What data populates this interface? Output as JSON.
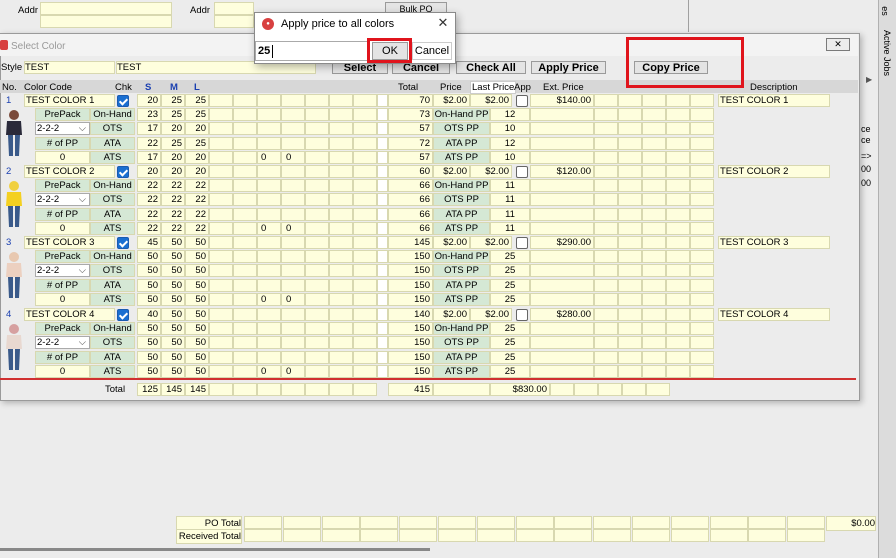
{
  "background": {
    "addr_label_1": "Addr",
    "addr_label_2": "Addr",
    "bulk_po_label": "Bulk PO",
    "right_tabs": [
      "Active Jobs",
      "es"
    ],
    "right_frag": [
      "ce",
      "ce",
      "=>",
      "00",
      "00"
    ],
    "po_total_label": "PO Total",
    "received_total_label": "Received Total",
    "po_total_value": "$0.00"
  },
  "dialog": {
    "title": "Apply price to all colors",
    "input_value": "25",
    "ok_label": "OK",
    "cancel_label": "Cancel"
  },
  "window": {
    "title": "Select Color",
    "style_label": "Style",
    "style_value": "TEST",
    "style_desc": "TEST",
    "buttons": {
      "select": "Select",
      "cancel": "Cancel",
      "check_all": "Check All",
      "apply_price": "Apply Price",
      "copy_price": "Copy Price"
    },
    "headers": {
      "no": "No.",
      "color_code": "Color Code",
      "chk": "Chk",
      "s": "S",
      "m": "M",
      "l": "L",
      "total": "Total",
      "price": "Price",
      "last_price": "Last Price",
      "app": "App",
      "ext_price": "Ext. Price",
      "description": "Description"
    },
    "sub_labels": {
      "prepack": "PrePack",
      "prepack_value": "2-2-2",
      "num_pp": "# of PP",
      "num_pp_value": "0",
      "on_hand": "On-Hand",
      "ots": "OTS",
      "ata": "ATA",
      "ats": "ATS",
      "on_hand_pp": "On-Hand PP",
      "ots_pp": "OTS PP",
      "ata_pp": "ATA PP",
      "ats_pp": "ATS PP"
    },
    "colors": [
      {
        "no": "1",
        "code": "TEST COLOR 1",
        "description": "TEST COLOR 1",
        "main": [
          "20",
          "25",
          "25"
        ],
        "total": "70",
        "price": "$2.00",
        "last_price": "$2.00",
        "ext_price": "$140.00",
        "on_hand": [
          "23",
          "25",
          "25"
        ],
        "ots": [
          "17",
          "20",
          "20"
        ],
        "ata": [
          "22",
          "25",
          "25"
        ],
        "ats": [
          "17",
          "20",
          "20"
        ],
        "ats_extra": [
          "0",
          "0"
        ],
        "totals": [
          "73",
          "57",
          "72",
          "57"
        ],
        "pp": [
          "12",
          "10",
          "12",
          "10"
        ]
      },
      {
        "no": "2",
        "code": "TEST COLOR 2",
        "description": "TEST COLOR 2",
        "main": [
          "20",
          "20",
          "20"
        ],
        "total": "60",
        "price": "$2.00",
        "last_price": "$2.00",
        "ext_price": "$120.00",
        "on_hand": [
          "22",
          "22",
          "22"
        ],
        "ots": [
          "22",
          "22",
          "22"
        ],
        "ata": [
          "22",
          "22",
          "22"
        ],
        "ats": [
          "22",
          "22",
          "22"
        ],
        "ats_extra": [
          "0",
          "0"
        ],
        "totals": [
          "66",
          "66",
          "66",
          "66"
        ],
        "pp": [
          "11",
          "11",
          "11",
          "11"
        ]
      },
      {
        "no": "3",
        "code": "TEST COLOR 3",
        "description": "TEST COLOR 3",
        "main": [
          "45",
          "50",
          "50"
        ],
        "total": "145",
        "price": "$2.00",
        "last_price": "$2.00",
        "ext_price": "$290.00",
        "on_hand": [
          "50",
          "50",
          "50"
        ],
        "ots": [
          "50",
          "50",
          "50"
        ],
        "ata": [
          "50",
          "50",
          "50"
        ],
        "ats": [
          "50",
          "50",
          "50"
        ],
        "ats_extra": [
          "0",
          "0"
        ],
        "totals": [
          "150",
          "150",
          "150",
          "150"
        ],
        "pp": [
          "25",
          "25",
          "25",
          "25"
        ]
      },
      {
        "no": "4",
        "code": "TEST COLOR 4",
        "description": "TEST COLOR 4",
        "main": [
          "40",
          "50",
          "50"
        ],
        "total": "140",
        "price": "$2.00",
        "last_price": "$2.00",
        "ext_price": "$280.00",
        "on_hand": [
          "50",
          "50",
          "50"
        ],
        "ots": [
          "50",
          "50",
          "50"
        ],
        "ata": [
          "50",
          "50",
          "50"
        ],
        "ats": [
          "50",
          "50",
          "50"
        ],
        "ats_extra": [
          "0",
          "0"
        ],
        "totals": [
          "150",
          "150",
          "150",
          "150"
        ],
        "pp": [
          "25",
          "25",
          "25",
          "25"
        ]
      }
    ],
    "footer": {
      "label": "Total",
      "s": "125",
      "m": "145",
      "l": "145",
      "total": "415",
      "ext": "$830.00"
    }
  },
  "colors_theme": {
    "cell_bg": "#fefedd",
    "label_bg": "#d5e8d5",
    "checkbox_blue": "#1a6fd1",
    "highlight_red": "#e0141c"
  }
}
